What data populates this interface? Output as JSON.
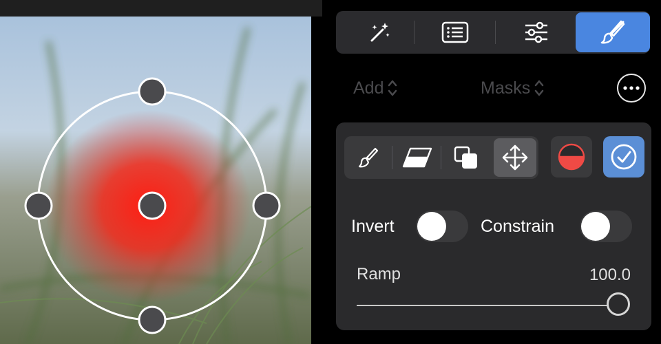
{
  "colors": {
    "accent": "#4a86e0",
    "mask_overlay": "#ff1e14",
    "inactive_text": "#4a4a4d"
  },
  "toolbar": {
    "items": [
      {
        "icon": "magic-wand-icon",
        "active": false
      },
      {
        "icon": "list-icon",
        "active": false
      },
      {
        "icon": "sliders-icon",
        "active": false
      },
      {
        "icon": "brush-icon",
        "active": true
      }
    ]
  },
  "header": {
    "add_label": "Add",
    "masks_label": "Masks",
    "more_icon": "ellipsis-icon"
  },
  "mask_tools": {
    "items": [
      {
        "icon": "brush-icon",
        "active": false
      },
      {
        "icon": "eraser-icon",
        "active": false
      },
      {
        "icon": "overlap-icon",
        "active": false
      },
      {
        "icon": "move-arrows-icon",
        "active": true
      }
    ],
    "overlay_icon": "half-red-circle-icon",
    "confirm_icon": "checkmark-circle-icon"
  },
  "options": {
    "invert_label": "Invert",
    "invert_on": false,
    "constrain_label": "Constrain",
    "constrain_on": false
  },
  "ramp": {
    "label": "Ramp",
    "value_text": "100.0",
    "value": 100.0,
    "max": 100.0
  }
}
